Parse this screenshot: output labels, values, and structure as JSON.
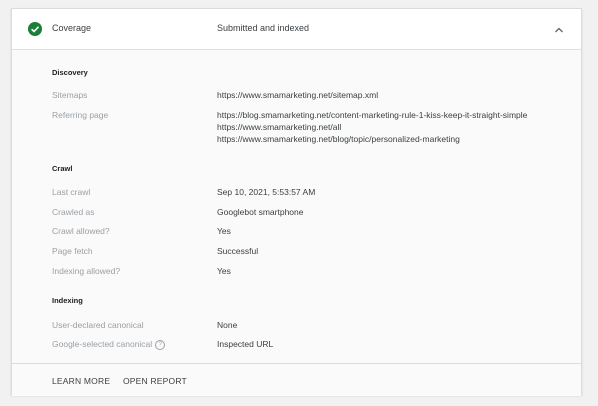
{
  "header": {
    "label": "Coverage",
    "value": "Submitted and indexed",
    "status_icon": "check-circle-icon",
    "toggle_icon": "chevron-up-icon",
    "status_color": "#188038"
  },
  "discovery": {
    "title": "Discovery",
    "sitemaps_label": "Sitemaps",
    "sitemaps_value": "https://www.smamarketing.net/sitemap.xml",
    "referring_label": "Referring page",
    "referring_values": [
      "https://blog.smamarketing.net/content-marketing-rule-1-kiss-keep-it-straight-simple",
      "https://www.smamarketing.net/all",
      "https://www.smamarketing.net/blog/topic/personalized-marketing"
    ]
  },
  "crawl": {
    "title": "Crawl",
    "rows": [
      {
        "label": "Last crawl",
        "value": "Sep 10, 2021, 5:53:57 AM"
      },
      {
        "label": "Crawled as",
        "value": "Googlebot smartphone"
      },
      {
        "label": "Crawl allowed?",
        "value": "Yes"
      },
      {
        "label": "Page fetch",
        "value": "Successful"
      },
      {
        "label": "Indexing allowed?",
        "value": "Yes"
      }
    ]
  },
  "indexing": {
    "title": "Indexing",
    "rows": [
      {
        "label": "User-declared canonical",
        "value": "None"
      },
      {
        "label": "Google-selected canonical",
        "value": "Inspected URL",
        "help_icon": "help-circle-icon"
      }
    ]
  },
  "footer": {
    "learn_more": "LEARN MORE",
    "open_report": "OPEN REPORT"
  }
}
